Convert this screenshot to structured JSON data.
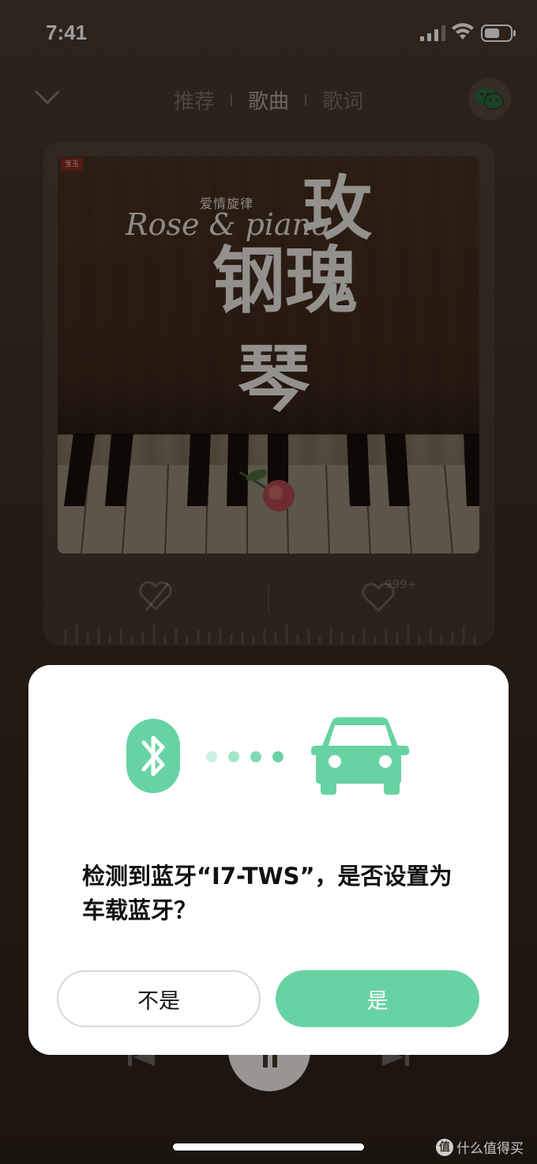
{
  "status_bar": {
    "time": "7:41"
  },
  "nav": {
    "tabs": [
      {
        "label": "推荐",
        "active": false
      },
      {
        "label": "歌曲",
        "active": true
      },
      {
        "label": "歌词",
        "active": false
      }
    ]
  },
  "album": {
    "stamp": "宝玉",
    "subtitle": "爱情旋律",
    "title_en": "Rose & piano",
    "title_cn": [
      "玫",
      "钢瑰",
      "琴"
    ],
    "like_count": "999+"
  },
  "dialog": {
    "message": "检测到蓝牙“I7-TWS”，是否设置为车载蓝牙？",
    "no_label": "不是",
    "yes_label": "是",
    "accent_color": "#68d3a2"
  },
  "watermark": {
    "icon_text": "值",
    "text": "什么值得买"
  },
  "icons": {
    "status": [
      "signal-icon",
      "wifi-icon",
      "battery-icon"
    ],
    "nav": [
      "collapse-icon",
      "wechat-icon"
    ],
    "card": [
      "dislike-icon",
      "like-icon"
    ],
    "dialog": [
      "bluetooth-icon",
      "car-icon"
    ],
    "playback": [
      "prev-icon",
      "pause-icon",
      "next-icon"
    ]
  }
}
